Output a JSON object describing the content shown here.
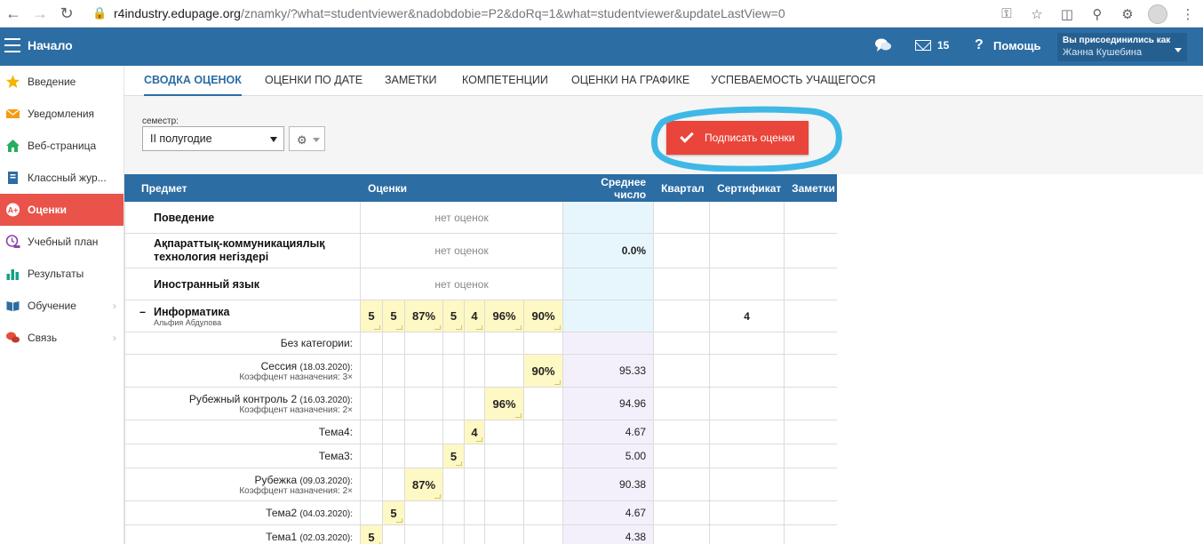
{
  "browser": {
    "url_host": "r4industry.edupage.org",
    "url_path": "/znamky/?what=studentviewer&nadobdobie=P2&doRq=1&what=studentviewer&updateLastView=0"
  },
  "header": {
    "title": "Начало",
    "mail_count": "15",
    "help": "Помощь",
    "joined_as": "Вы присоединились как",
    "user_name": "Жанна Кушебина"
  },
  "sidebar": {
    "items": [
      {
        "label": "Введение"
      },
      {
        "label": "Уведомления"
      },
      {
        "label": "Веб-страница"
      },
      {
        "label": "Классный жур..."
      },
      {
        "label": "Оценки"
      },
      {
        "label": "Учебный план"
      },
      {
        "label": "Результаты"
      },
      {
        "label": "Обучение"
      },
      {
        "label": "Связь"
      }
    ]
  },
  "tabs": [
    {
      "label": "СВОДКА ОЦЕНОК"
    },
    {
      "label": "ОЦЕНКИ ПО ДАТЕ"
    },
    {
      "label": "ЗАМЕТКИ"
    },
    {
      "label": "КОМПЕТЕНЦИИ"
    },
    {
      "label": "ОЦЕНКИ НА ГРАФИКЕ"
    },
    {
      "label": "УСПЕВАЕМОСТЬ УЧАЩЕГОСЯ"
    }
  ],
  "filter": {
    "semester_label": "семестр:",
    "semester_value": "II полугодие"
  },
  "sign_button": "Подписать оценки",
  "colors": {
    "header_blue": "#2c6da4",
    "accent_red": "#e9453a",
    "highlight_ring": "#3fb8e6",
    "grade_bg": "#fdf8c4"
  },
  "table": {
    "headers": {
      "subject": "Предмет",
      "grades": "Оценки",
      "average": "Среднее число",
      "quarter": "Квартал",
      "certificate": "Сертификат",
      "notes": "Заметки"
    },
    "no_grades": "нет оценок",
    "subjects": [
      {
        "name": "Поведение"
      },
      {
        "name": "Ақпараттық-коммуникациялық технология негіздері",
        "average": "0.0%"
      },
      {
        "name": "Иностранный язык"
      },
      {
        "name": "Информатика",
        "teacher": "Альфия Абдулова",
        "certificate": "4",
        "grades": [
          "5",
          "5",
          "87%",
          "5",
          "4",
          "96%",
          "90%"
        ]
      }
    ],
    "categories": [
      {
        "name": "Без категории:"
      },
      {
        "name": "Сессия",
        "date": "(18.03.2020):",
        "coef": "Коэффцент назначения: 3×",
        "grade": "90%",
        "col": 6,
        "average": "95.33"
      },
      {
        "name": "Рубежный контроль 2",
        "date": "(16.03.2020):",
        "coef": "Коэффцент назначения: 2×",
        "grade": "96%",
        "col": 5,
        "average": "94.96"
      },
      {
        "name": "Тема4:",
        "grade": "4",
        "col": 4,
        "average": "4.67"
      },
      {
        "name": "Тема3:",
        "grade": "5",
        "col": 3,
        "average": "5.00"
      },
      {
        "name": "Рубежка",
        "date": "(09.03.2020):",
        "coef": "Коэффцент назначения: 2×",
        "grade": "87%",
        "col": 2,
        "average": "90.38"
      },
      {
        "name": "Тема2",
        "date": "(04.03.2020):",
        "grade": "5",
        "col": 1,
        "average": "4.67"
      },
      {
        "name": "Тема1",
        "date": "(02.03.2020):",
        "grade": "5",
        "col": 0,
        "average": "4.38"
      }
    ]
  }
}
